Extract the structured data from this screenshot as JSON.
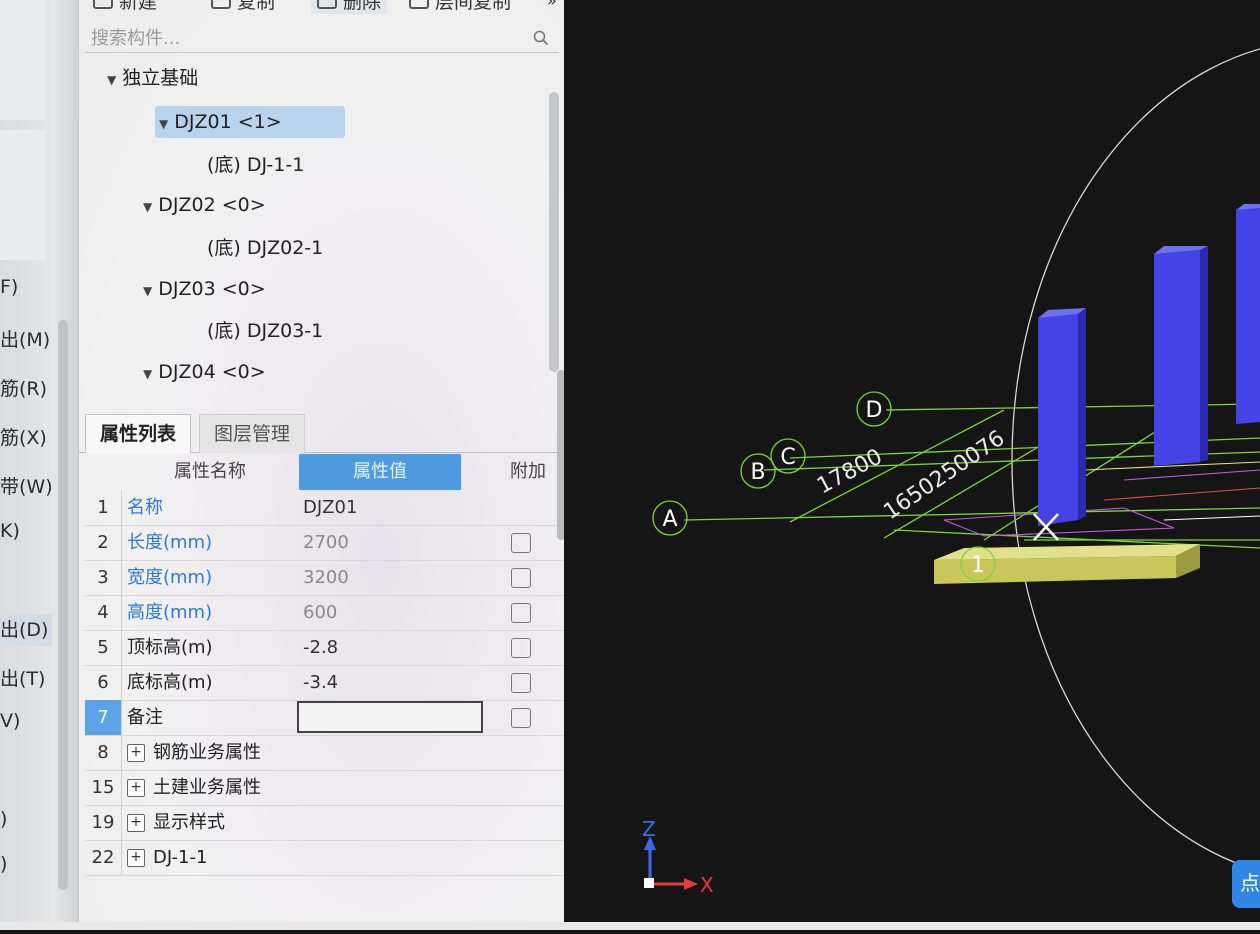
{
  "left_menu": {
    "items": [
      {
        "label": "F)"
      },
      {
        "label": "出(M)"
      },
      {
        "label": "筋(R)"
      },
      {
        "label": "筋(X)"
      },
      {
        "label": "带(W)"
      },
      {
        "label": "K)"
      },
      {
        "label": "出(D)"
      },
      {
        "label": "出(T)"
      },
      {
        "label": "V)"
      },
      {
        "label": ")"
      },
      {
        "label": ")"
      }
    ]
  },
  "toolbar": {
    "new_label": "新建",
    "copy_label": "复制",
    "delete_label": "删除",
    "floor_copy_label": "层间复制",
    "more_label": "»"
  },
  "search": {
    "placeholder": "搜索构件..."
  },
  "tree": {
    "root": "独立基础",
    "nodes": [
      {
        "label": "DJZ01  <1>"
      },
      {
        "label": "(底)  DJ-1-1"
      },
      {
        "label": "DJZ02  <0>"
      },
      {
        "label": "(底)  DJZ02-1"
      },
      {
        "label": "DJZ03  <0>"
      },
      {
        "label": "(底)  DJZ03-1"
      },
      {
        "label": "DJZ04  <0>"
      }
    ]
  },
  "tabs": [
    {
      "label": "属性列表"
    },
    {
      "label": "图层管理"
    }
  ],
  "properties": {
    "header": {
      "name": "属性名称",
      "value": "属性值",
      "extra": "附加"
    },
    "rows": [
      {
        "num": "1",
        "name": "名称",
        "value": "DJZ01"
      },
      {
        "num": "2",
        "name": "长度(mm)",
        "value": "2700"
      },
      {
        "num": "3",
        "name": "宽度(mm)",
        "value": "3200"
      },
      {
        "num": "4",
        "name": "高度(mm)",
        "value": "600"
      },
      {
        "num": "5",
        "name": "顶标高(m)",
        "value": "-2.8"
      },
      {
        "num": "6",
        "name": "底标高(m)",
        "value": "-3.4"
      },
      {
        "num": "7",
        "name": "备注",
        "value": ""
      },
      {
        "num": "8",
        "name": "钢筋业务属性"
      },
      {
        "num": "15",
        "name": "土建业务属性"
      },
      {
        "num": "19",
        "name": "显示样式"
      },
      {
        "num": "22",
        "name": "DJ-1-1"
      }
    ]
  },
  "viewport": {
    "axis_labels": [
      "A",
      "B",
      "C",
      "D",
      "1"
    ],
    "dim_1": "17800",
    "dim_2": "1650250076",
    "axis_z": "Z",
    "axis_x": "X",
    "corner_button": "点",
    "colors": {
      "column": "#4444e6",
      "footing": "#c9c75a",
      "grid_line": "#7cd43c",
      "background": "#151515"
    }
  }
}
